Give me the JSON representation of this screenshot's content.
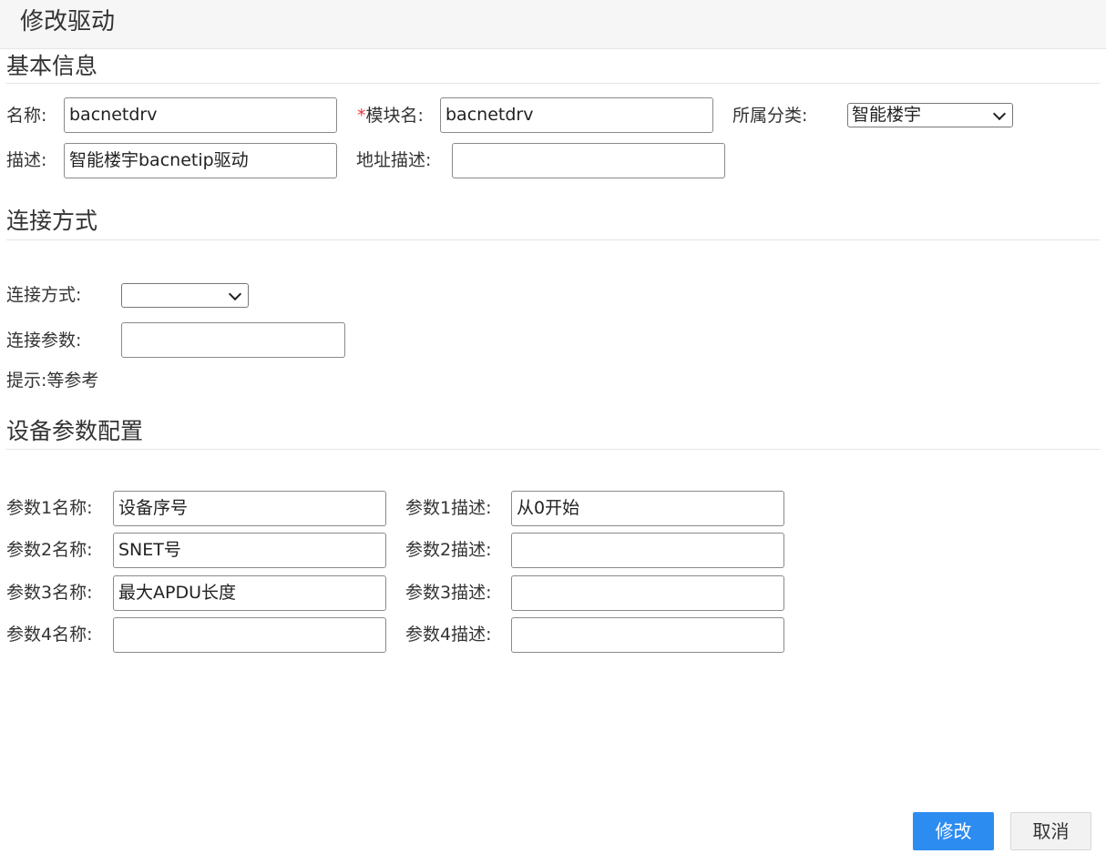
{
  "header": {
    "title": "修改驱动"
  },
  "basic": {
    "section_title": "基本信息",
    "name_label": "名称:",
    "name_value": "bacnetdrv",
    "module_required_mark": "*",
    "module_label": "模块名:",
    "module_value": "bacnetdrv",
    "category_label": "所属分类:",
    "category_value": "智能楼宇",
    "desc_label": "描述:",
    "desc_value": "智能楼宇bacnetip驱动",
    "addr_desc_label": "地址描述:",
    "addr_desc_value": ""
  },
  "connection": {
    "section_title": "连接方式",
    "mode_label": "连接方式:",
    "mode_value": "",
    "params_label": "连接参数:",
    "params_value": "",
    "hint": "提示:等参考"
  },
  "device": {
    "section_title": "设备参数配置",
    "params": [
      {
        "name_label": "参数1名称:",
        "name_value": "设备序号",
        "desc_label": "参数1描述:",
        "desc_value": "从0开始"
      },
      {
        "name_label": "参数2名称:",
        "name_value": "SNET号",
        "desc_label": "参数2描述:",
        "desc_value": ""
      },
      {
        "name_label": "参数3名称:",
        "name_value": "最大APDU长度",
        "desc_label": "参数3描述:",
        "desc_value": ""
      },
      {
        "name_label": "参数4名称:",
        "name_value": "",
        "desc_label": "参数4描述:",
        "desc_value": ""
      }
    ]
  },
  "actions": {
    "submit_label": "修改",
    "cancel_label": "取消"
  },
  "colors": {
    "primary": "#2d8cf0",
    "required": "#e53935",
    "header_bg": "#f6f6f6"
  }
}
